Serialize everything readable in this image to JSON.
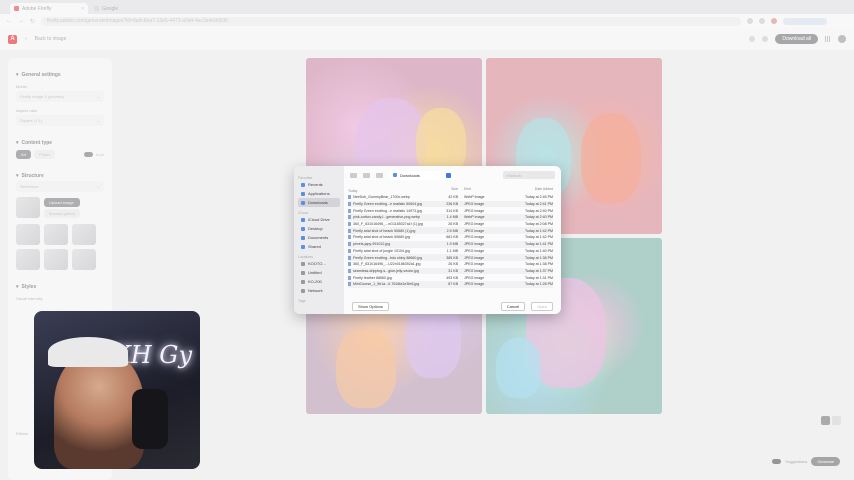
{
  "browser": {
    "tabs": [
      {
        "label": "Adobe Firefly"
      },
      {
        "label": "Google"
      }
    ],
    "url": "firefly.adobe.com/generate/images?id=9a9c8ea7-13e5-4473-a0d4-4ec3a4e9d63b"
  },
  "app": {
    "back_label": "Back to image",
    "download_label": "Download all"
  },
  "left_panel": {
    "general_title": "General settings",
    "model_label": "Model",
    "model_value": "Firefly Image 3 (preview)",
    "aspect_label": "Aspect ratio",
    "aspect_value": "Square (1:1)",
    "content_title": "Content type",
    "content_auto": "Auto",
    "content_art": "Art",
    "content_photo": "Photo",
    "structure_title": "Structure",
    "reference_label": "Reference",
    "upload_label": "Upload image",
    "browse_label": "Browse gallery",
    "styles_title": "Styles",
    "styles_sub": "Visual intensity",
    "effects_label": "Effects"
  },
  "dialog": {
    "sidebar": {
      "favorites_label": "Favorites",
      "favorites": [
        "Recents",
        "Applications",
        "Downloads"
      ],
      "icloud_label": "iCloud",
      "icloud": [
        "iCloud Drive",
        "Desktop",
        "Documents",
        "Shared"
      ],
      "locations_label": "Locations",
      "locations": [
        "KOOTO...",
        "Untitled",
        "KO-200",
        "Network"
      ],
      "tags_label": "Tags"
    },
    "location": "Downloads",
    "search_placeholder": "Search",
    "columns": {
      "name": "Today",
      "size": "Size",
      "kind": "Kind",
      "date": "Date Added"
    },
    "files": [
      {
        "name": "NeeDoh_GummyBear_1700x.webp",
        "size": "42 KB",
        "kind": "WebP image",
        "date": "Today at 2:45 PM"
      },
      {
        "name": "Firefly Green exciting...e realistic 50604.jpg",
        "size": "236 KB",
        "kind": "JPEG image",
        "date": "Today at 2:41 PM"
      },
      {
        "name": "Firefly Green exciting...e realistic 14973.jpg",
        "size": "314 KB",
        "kind": "JPEG image",
        "date": "Today at 2:40 PM"
      },
      {
        "name": "pink-cotton-candy-l...generative-png.webp",
        "size": "1.4 MB",
        "kind": "WebP image",
        "date": "Today at 2:40 PM"
      },
      {
        "name": "360_F_631016496_...nG1165027a1f (1).jpg",
        "size": "26 KB",
        "kind": "JPEG image",
        "date": "Today at 2:08 PM"
      },
      {
        "name": "Firefly arial shot of beach 50680 (1).jpg",
        "size": "2.5 MB",
        "kind": "JPEG image",
        "date": "Today at 1:42 PM"
      },
      {
        "name": "Firefly arial shot of beach 50680.jpg",
        "size": "681 KB",
        "kind": "JPEG image",
        "date": "Today at 1:42 PM"
      },
      {
        "name": "pexels-japy-991012.jpg",
        "size": "1.9 MB",
        "kind": "JPEG image",
        "date": "Today at 1:41 PM"
      },
      {
        "name": "Firefly arial shot of jungle 10104.jpg",
        "size": "1.1 MB",
        "kind": "JPEG image",
        "date": "Today at 1:40 PM"
      },
      {
        "name": "Firefly Green exciting...bdo shiny 88660.jpg",
        "size": "385 KB",
        "kind": "JPEG image",
        "date": "Today at 1:38 PM"
      },
      {
        "name": "360_F_631016496_...U22n0186392a1.jpg",
        "size": "26 KB",
        "kind": "JPEG image",
        "date": "Today at 1:38 PM"
      },
      {
        "name": "seamless-dripping-s...glue-jelly-vector.jpg",
        "size": "31 KB",
        "kind": "JPEG image",
        "date": "Today at 1:37 PM"
      },
      {
        "name": "Firefly feather 88660.jpg",
        "size": "493 KB",
        "kind": "JPEG image",
        "date": "Today at 1:31 PM"
      },
      {
        "name": "MiniCourse_1_9b1a...0-7616fa1e3fe6.jpg",
        "size": "87 KB",
        "kind": "JPEG image",
        "date": "Today at 1:28 PM"
      }
    ],
    "show_options": "Show Options",
    "cancel": "Cancel",
    "open": "Open"
  },
  "webcam": {
    "neon_text": "KH Gy"
  },
  "bottom": {
    "suggestions_label": "Suggestions",
    "generate_label": "Generate"
  }
}
